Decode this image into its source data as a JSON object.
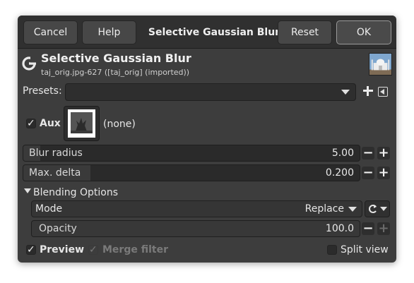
{
  "header": {
    "cancel_label": "Cancel",
    "help_label": "Help",
    "title": "Selective Gaussian Blur",
    "reset_label": "Reset",
    "ok_label": "OK"
  },
  "filter": {
    "title": "Selective Gaussian Blur",
    "subtitle": "taj_orig.jpg-627 ([taj_orig] (imported))"
  },
  "presets": {
    "label": "Presets:",
    "value": ""
  },
  "aux": {
    "label": "Aux",
    "checked": true,
    "value": "(none)"
  },
  "params": {
    "blur_radius": {
      "label": "Blur radius",
      "value": "5.00",
      "level": 0.05
    },
    "max_delta": {
      "label": "Max. delta",
      "value": "0.200",
      "level": 0.2
    }
  },
  "blending": {
    "label": "Blending Options",
    "mode_label": "Mode",
    "mode_value": "Replace",
    "opacity_label": "Opacity",
    "opacity_value": "100.0",
    "opacity_level": 1.0
  },
  "footer": {
    "preview_label": "Preview",
    "preview_checked": true,
    "merge_label": "Merge filter",
    "merge_checked": true,
    "split_label": "Split view",
    "split_checked": false
  },
  "colors": {
    "dialog_bg": "#3d3d3d",
    "header_bg": "#303030",
    "field_bg": "#2a2a2a"
  }
}
